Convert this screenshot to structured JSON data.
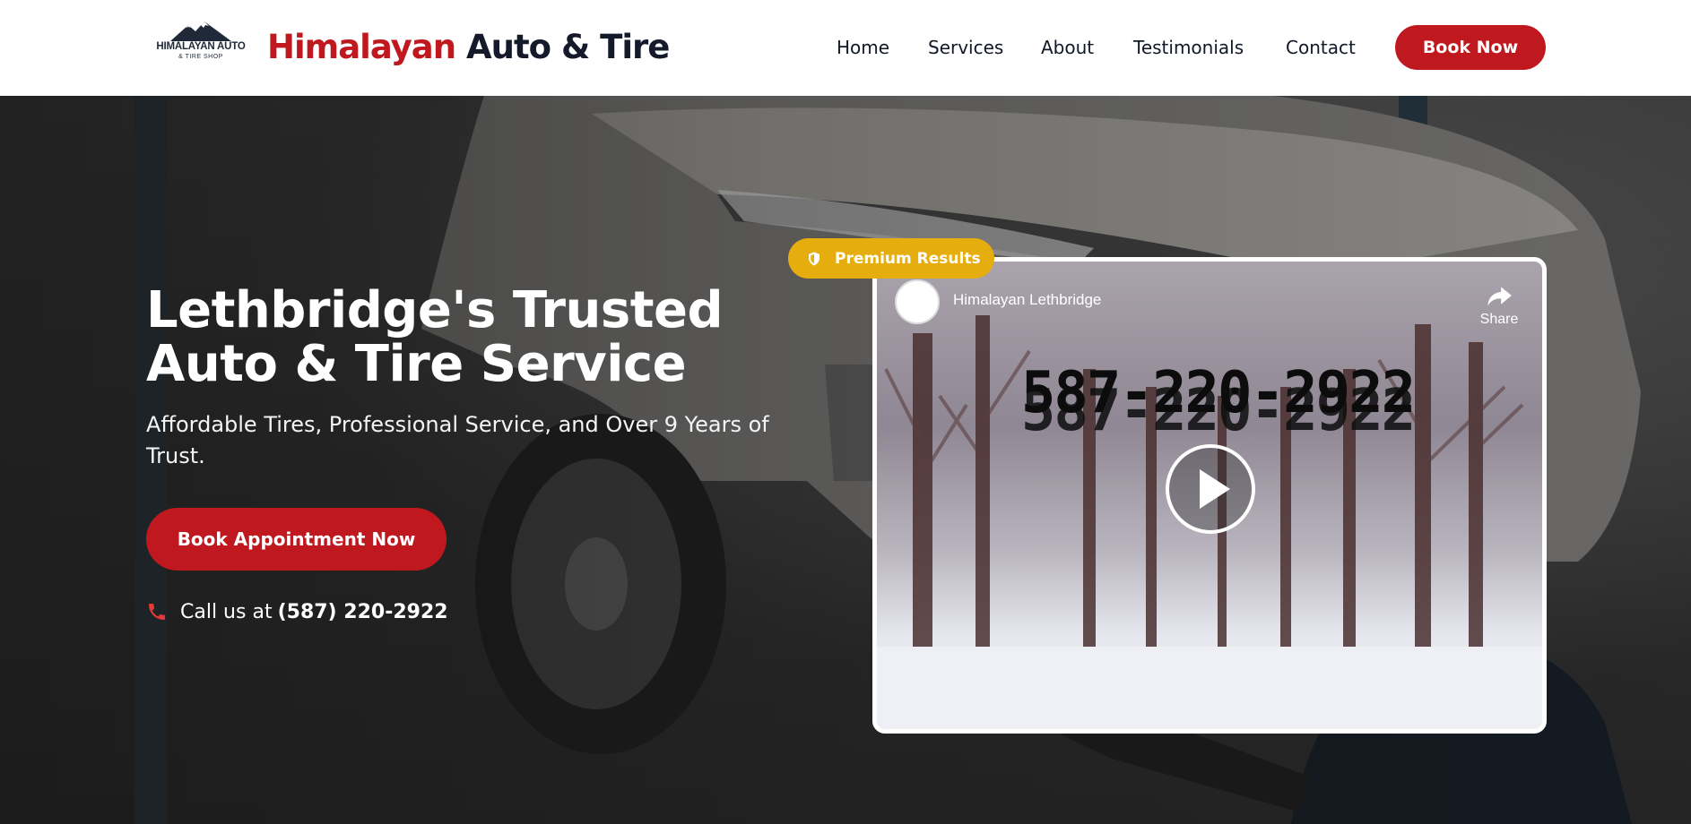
{
  "header": {
    "logo": {
      "line1": "HIMALAYAN AUTO",
      "line2": "& TIRE SHOP",
      "icon": "mountain-logo-icon"
    },
    "brand": {
      "part1": "Himalayan",
      "part2": "Auto & Tire"
    },
    "nav": [
      {
        "label": "Home"
      },
      {
        "label": "Services"
      },
      {
        "label": "About"
      },
      {
        "label": "Testimonials"
      },
      {
        "label": "Contact"
      }
    ],
    "cta": "Book Now"
  },
  "hero": {
    "title_line1": "Lethbridge's Trusted",
    "title_line2": "Auto & Tire Service",
    "subtitle": "Affordable Tires, Professional Service, and Over 9 Years of Trust.",
    "cta": "Book Appointment Now",
    "call_prefix": "Call us at",
    "phone": "(587) 220-2922"
  },
  "badge": {
    "label": "Premium Results",
    "icon": "shield-icon"
  },
  "video": {
    "channel": "Himalayan Lethbridge",
    "share_label": "Share",
    "number_text": "587-220-2922",
    "icons": [
      "share-icon",
      "play-icon"
    ]
  },
  "colors": {
    "brand_red": "#c0181f",
    "badge_gold": "#e6ad0e",
    "dark_text": "#151a2b"
  }
}
